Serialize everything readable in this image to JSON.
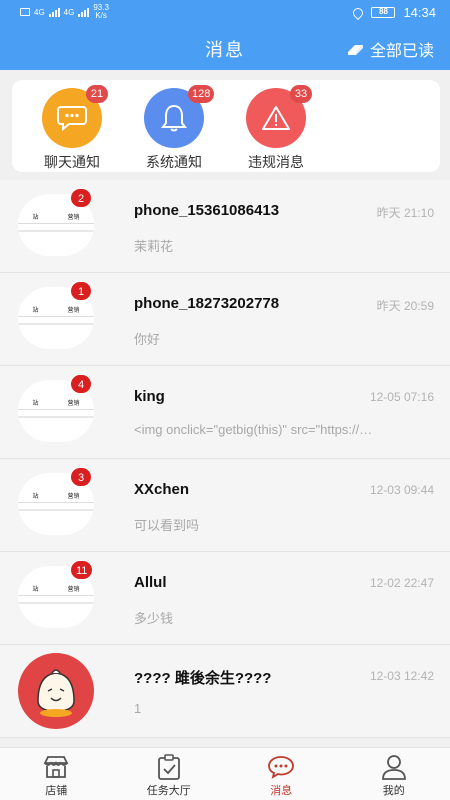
{
  "status_bar": {
    "speed_value": "93.3",
    "speed_unit": "K/s",
    "signal_a": "4G",
    "signal_b": "4G",
    "battery": "88",
    "time": "14:34"
  },
  "header": {
    "title": "消息",
    "mark_all_read": "全部已读"
  },
  "categories": [
    {
      "label": "聊天通知",
      "badge": "21",
      "color": "#f5a623",
      "icon": "chat-bubble-icon"
    },
    {
      "label": "系统通知",
      "badge": "128",
      "color": "#5b8def",
      "icon": "bell-icon"
    },
    {
      "label": "违规消息",
      "badge": "33",
      "color": "#f05a5a",
      "icon": "warning-icon"
    }
  ],
  "avatar_strip": {
    "left": "站",
    "right": "营销"
  },
  "messages": [
    {
      "name": "phone_15361086413",
      "time": "昨天 21:10",
      "preview": "茉莉花",
      "badge": "2"
    },
    {
      "name": "phone_18273202778",
      "time": "昨天 20:59",
      "preview": "你好",
      "badge": "1"
    },
    {
      "name": "king",
      "time": "12-05 07:16",
      "preview": "<img onclick=\"getbig(this)\" src=\"https://…",
      "badge": "4"
    },
    {
      "name": "XXchen",
      "time": "12-03 09:44",
      "preview": "可以看到吗",
      "badge": "3"
    },
    {
      "name": "Allul",
      "time": "12-02 22:47",
      "preview": "多少钱",
      "badge": "11"
    },
    {
      "name": "???? 雎後余生????",
      "time": "12-03 12:42",
      "preview": "1",
      "badge": ""
    }
  ],
  "bottom_nav": [
    {
      "label": "店铺",
      "icon": "store-icon",
      "active": false
    },
    {
      "label": "任务大厅",
      "icon": "clipboard-check-icon",
      "active": false
    },
    {
      "label": "消息",
      "icon": "message-icon",
      "active": true
    },
    {
      "label": "我的",
      "icon": "profile-icon",
      "active": false
    }
  ]
}
